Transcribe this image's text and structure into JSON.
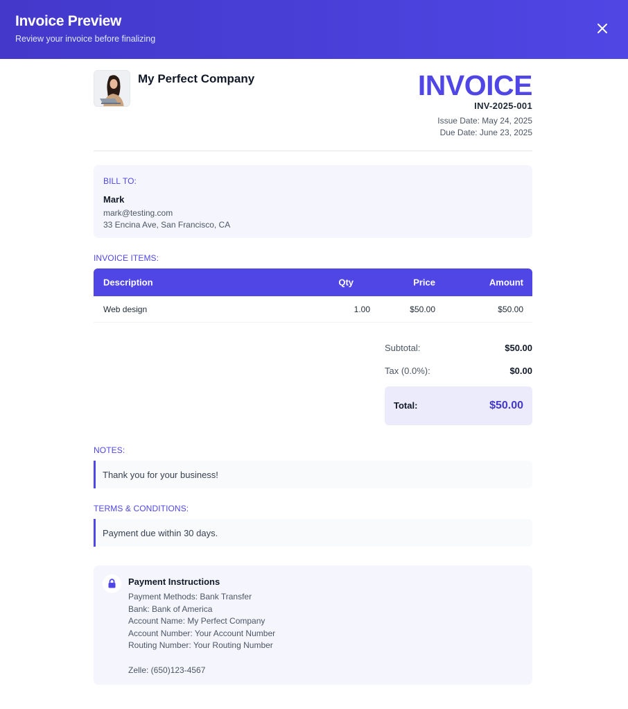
{
  "header": {
    "title": "Invoice Preview",
    "subtitle": "Review your invoice before finalizing"
  },
  "company": {
    "name": "My Perfect Company"
  },
  "invoice": {
    "heading": "INVOICE",
    "number": "INV-2025-001",
    "issue_date": "Issue Date: May 24, 2025",
    "due_date": "Due Date: June 23, 2025"
  },
  "bill_to": {
    "label": "BILL TO:",
    "name": "Mark",
    "email": "mark@testing.com",
    "address": "33 Encina Ave, San Francisco, CA"
  },
  "items": {
    "label": "INVOICE ITEMS:",
    "columns": {
      "description": "Description",
      "qty": "Qty",
      "price": "Price",
      "amount": "Amount"
    },
    "rows": [
      {
        "description": "Web design",
        "qty": "1.00",
        "price": "$50.00",
        "amount": "$50.00"
      }
    ]
  },
  "totals": {
    "subtotal_label": "Subtotal:",
    "subtotal_value": "$50.00",
    "tax_label": "Tax (0.0%):",
    "tax_value": "$0.00",
    "total_label": "Total:",
    "total_value": "$50.00"
  },
  "notes": {
    "label": "NOTES:",
    "text": "Thank you for your business!"
  },
  "terms": {
    "label": "TERMS & CONDITIONS:",
    "text": "Payment due within 30 days."
  },
  "payment": {
    "title": "Payment Instructions",
    "lines": [
      "Payment Methods: Bank Transfer",
      "Bank: Bank of America",
      "Account Name: My Perfect Company",
      "Account Number: Your Account Number",
      "Routing Number: Your Routing Number",
      "",
      "Zelle: (650)123-4567"
    ]
  },
  "icons": {
    "close": "close-icon",
    "lock": "lock-icon",
    "logo": "company-logo"
  },
  "colors": {
    "accent": "#4f46e5",
    "header_start": "#4338ca",
    "panel": "#f5f6fd",
    "total_panel": "#ebebfb"
  }
}
